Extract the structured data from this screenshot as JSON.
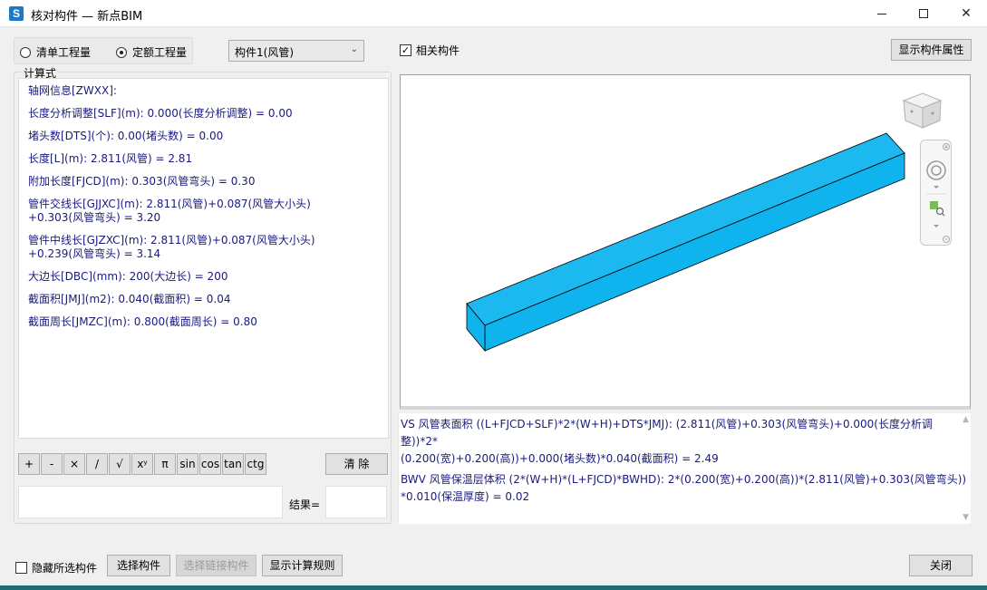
{
  "window": {
    "title": "核对构件 — 新点BIM",
    "icon_letter": "S",
    "minimize_icon": "minimize-icon",
    "maximize_icon": "maximize-icon",
    "close_glyph": "✕"
  },
  "mode": {
    "option1": "清单工程量",
    "option2": "定额工程量",
    "selected": "定额工程量"
  },
  "component_select": {
    "value": "构件1(风管)",
    "arrow": "⌄"
  },
  "related": {
    "label": "相关构件",
    "checked": true,
    "check_glyph": "✓"
  },
  "show_props_button": "显示构件属性",
  "formula": {
    "group_label": "计算式",
    "lines": [
      "轴网信息[ZWXX]:",
      "长度分析调整[SLF](m): 0.000(长度分析调整) = 0.00",
      "堵头数[DTS](个): 0.00(堵头数) = 0.00",
      "长度[L](m): 2.811(风管) = 2.81",
      "附加长度[FJCD](m): 0.303(风管弯头) = 0.30",
      "管件交线长[GJJXC](m): 2.811(风管)+0.087(风管大小头)",
      "+0.303(风管弯头) = 3.20",
      "管件中线长[GJZXC](m): 2.811(风管)+0.087(风管大小头)",
      "+0.239(风管弯头) = 3.14",
      "大边长[DBC](mm): 200(大边长) = 200",
      "截面积[JMJ](m2): 0.040(截面积) = 0.04",
      "截面周长[JMZC](m): 0.800(截面周长) = 0.80"
    ]
  },
  "calculator": {
    "keys": [
      "+",
      "-",
      "×",
      "/",
      "√",
      "xʸ",
      "π",
      "sin",
      "cos",
      "tan",
      "ctg"
    ],
    "clear_label": "清 除",
    "result_label": "结果=",
    "expression": "",
    "result": ""
  },
  "results": {
    "lines": [
      "VS 风管表面积 ((L+FJCD+SLF)*2*(W+H)+DTS*JMJ): (2.811(风管)+0.303(风管弯头)+0.000(长度分析调整))*2*",
      "(0.200(宽)+0.200(高))+0.000(堵头数)*0.040(截面积) = 2.49",
      "BWV 风管保温层体积 (2*(W+H)*(L+FJCD)*BWHD): 2*(0.200(宽)+0.200(高))*(2.811(风管)+0.303(风管弯头))",
      "*0.010(保温厚度) = 0.02"
    ]
  },
  "viewport": {
    "duct_color": "#0fb4ee",
    "duct_top_color": "#1cb8f0",
    "view_cube_icon": "view-cube-icon",
    "orbit_icon": "orbit-icon",
    "zoom_window_icon": "zoom-window-icon"
  },
  "bottom": {
    "hide_selected": "隐藏所选构件",
    "select_component": "选择构件",
    "select_linked": "选择链接构件",
    "show_rules": "显示计算规则",
    "close": "关闭"
  }
}
